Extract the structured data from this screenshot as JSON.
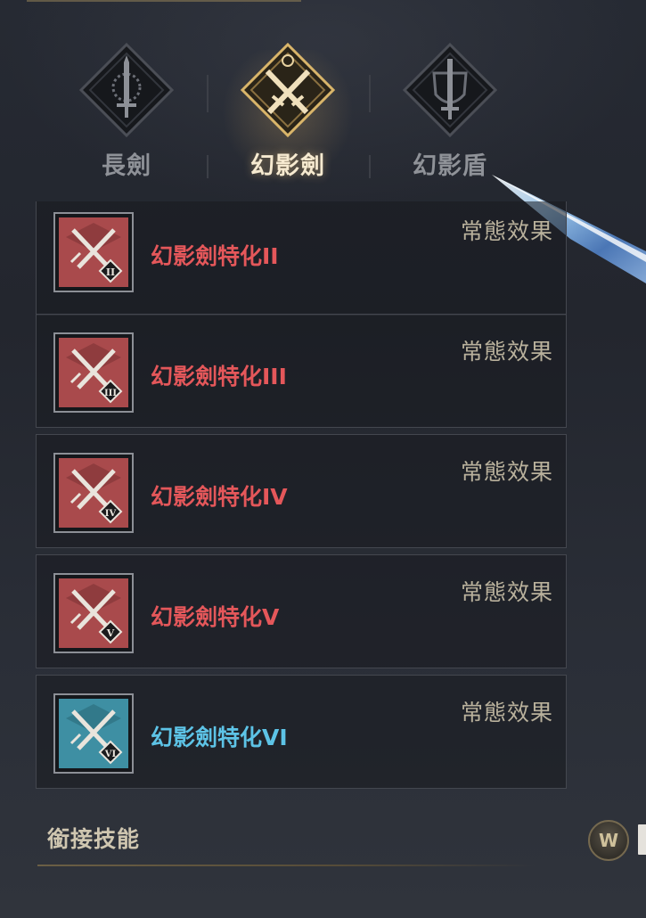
{
  "tabs": [
    {
      "label": "長劍",
      "icon": "longsword-emblem-icon",
      "active": false
    },
    {
      "label": "幻影劍",
      "icon": "crossed-swords-emblem-icon",
      "active": true
    },
    {
      "label": "幻影盾",
      "icon": "shield-sword-emblem-icon",
      "active": false
    }
  ],
  "skills": [
    {
      "name": "幻影劍特化II",
      "status": "常態效果",
      "numeral": "II",
      "tier_color": "red"
    },
    {
      "name": "幻影劍特化III",
      "status": "常態效果",
      "numeral": "III",
      "tier_color": "red"
    },
    {
      "name": "幻影劍特化IV",
      "status": "常態效果",
      "numeral": "IV",
      "tier_color": "red"
    },
    {
      "name": "幻影劍特化V",
      "status": "常態效果",
      "numeral": "V",
      "tier_color": "red"
    },
    {
      "name": "幻影劍特化VI",
      "status": "常態效果",
      "numeral": "VI",
      "tier_color": "blue"
    }
  ],
  "section": {
    "title": "銜接技能"
  },
  "coin_icon": {
    "glyph": "W"
  },
  "colors": {
    "red_name": "#e4575a",
    "blue_name": "#5dc3e6",
    "status_text": "#b9b19c",
    "active_tab": "#f6ead0",
    "inactive_tab": "#8f9298",
    "red_icon_bg": "#a94a4c",
    "blue_icon_bg": "#3e8fa3"
  }
}
